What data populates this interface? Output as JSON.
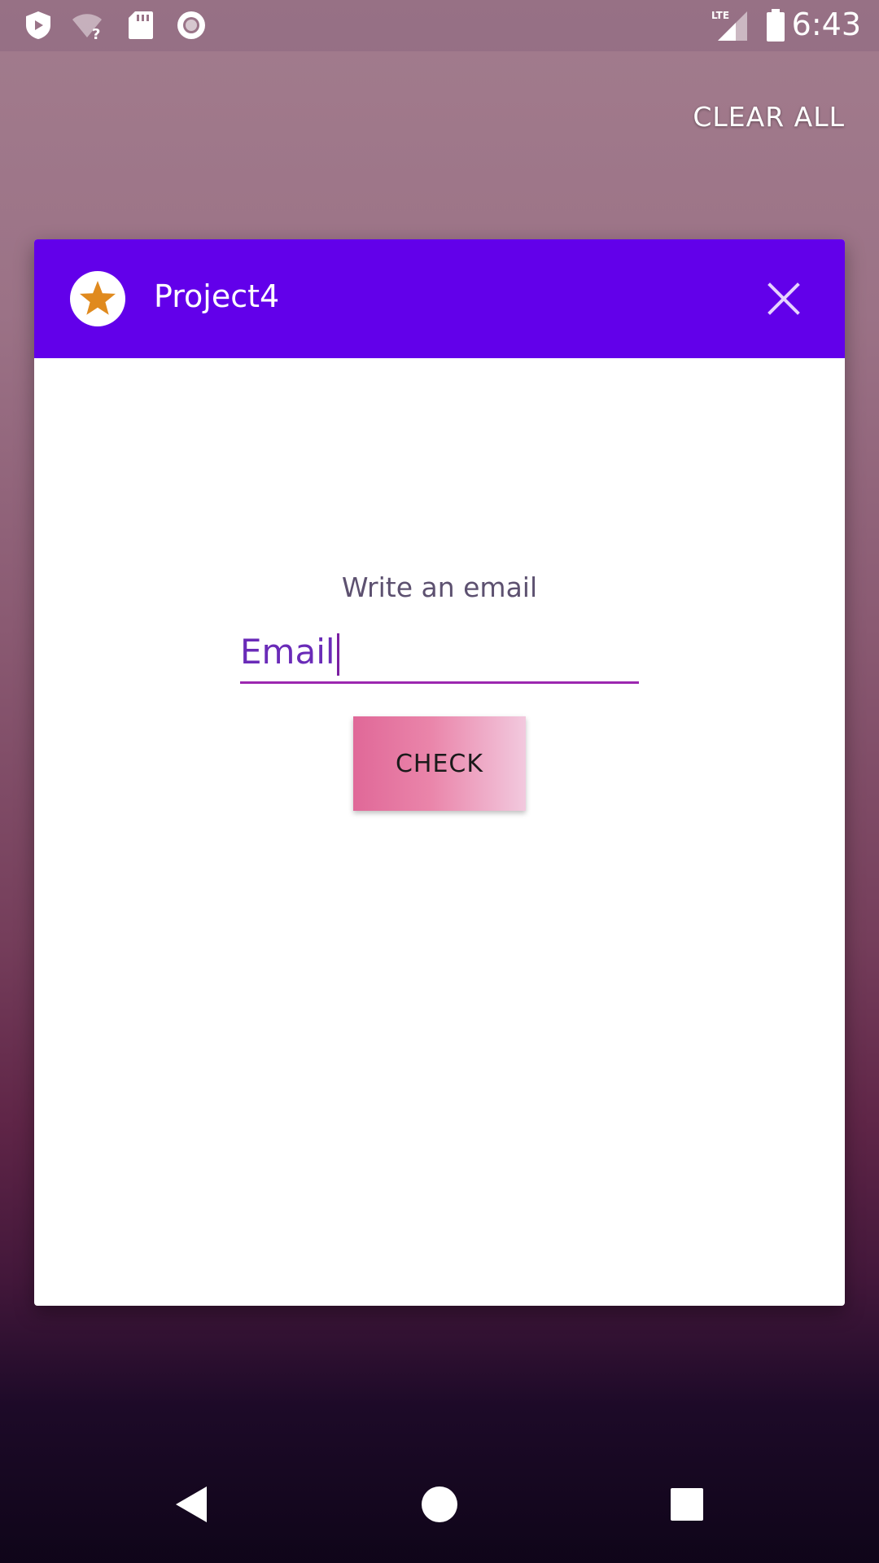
{
  "status_bar": {
    "time": "6:43",
    "network": "LTE",
    "icons": [
      "shield-icon",
      "wifi-unknown-icon",
      "sd-card-icon",
      "record-icon",
      "lte-signal-icon",
      "battery-icon"
    ]
  },
  "recents": {
    "clear_all_label": "CLEAR ALL"
  },
  "task_card": {
    "app_title": "Project4",
    "app_icon": "star-icon",
    "close_icon": "close-icon",
    "header_color": "#6200ea"
  },
  "form": {
    "prompt": "Write an email",
    "email_value": "Email",
    "check_label": "CHECK"
  },
  "nav_bar": {
    "icons": [
      "back-icon",
      "home-icon",
      "recents-icon"
    ]
  },
  "colors": {
    "accent": "#9c27b0",
    "header": "#6200ea",
    "button_gradient_start": "#e06898",
    "button_gradient_end": "#f2c9de"
  }
}
